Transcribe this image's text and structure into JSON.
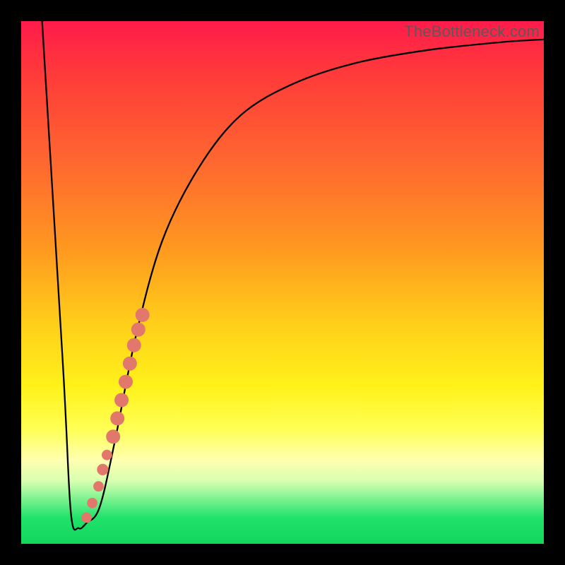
{
  "watermark": "TheBottleneck.com",
  "colors": {
    "curve_stroke": "#000000",
    "point_fill": "#e2776b",
    "background_black": "#000000"
  },
  "chart_data": {
    "type": "line",
    "title": "",
    "xlabel": "",
    "ylabel": "",
    "xlim": [
      0,
      100
    ],
    "ylim": [
      0,
      100
    ],
    "x": [
      4,
      8,
      9.5,
      11,
      12.5,
      15,
      18,
      22,
      27,
      34,
      42,
      52,
      64,
      78,
      92,
      100
    ],
    "values": [
      100,
      34,
      6,
      3,
      4,
      7,
      20,
      40,
      58,
      72,
      82,
      88,
      92,
      94.5,
      96,
      96.5
    ],
    "annotations_note": "Scatter points overlaid on the rising branch of the curve; values estimated from pixel positions (~3% precision).",
    "scatter_points": [
      {
        "x": 12.5,
        "y": 5.0,
        "r": 1.0
      },
      {
        "x": 13.6,
        "y": 7.8,
        "r": 1.0
      },
      {
        "x": 14.8,
        "y": 11.0,
        "r": 1.0
      },
      {
        "x": 15.6,
        "y": 14.2,
        "r": 1.1
      },
      {
        "x": 16.4,
        "y": 17.0,
        "r": 1.0
      },
      {
        "x": 17.6,
        "y": 20.5,
        "r": 1.35
      },
      {
        "x": 18.4,
        "y": 24.0,
        "r": 1.35
      },
      {
        "x": 19.2,
        "y": 27.5,
        "r": 1.35
      },
      {
        "x": 20.0,
        "y": 31.0,
        "r": 1.35
      },
      {
        "x": 20.8,
        "y": 34.5,
        "r": 1.35
      },
      {
        "x": 21.6,
        "y": 38.0,
        "r": 1.35
      },
      {
        "x": 22.4,
        "y": 41.0,
        "r": 1.35
      },
      {
        "x": 23.2,
        "y": 43.8,
        "r": 1.35
      }
    ]
  }
}
